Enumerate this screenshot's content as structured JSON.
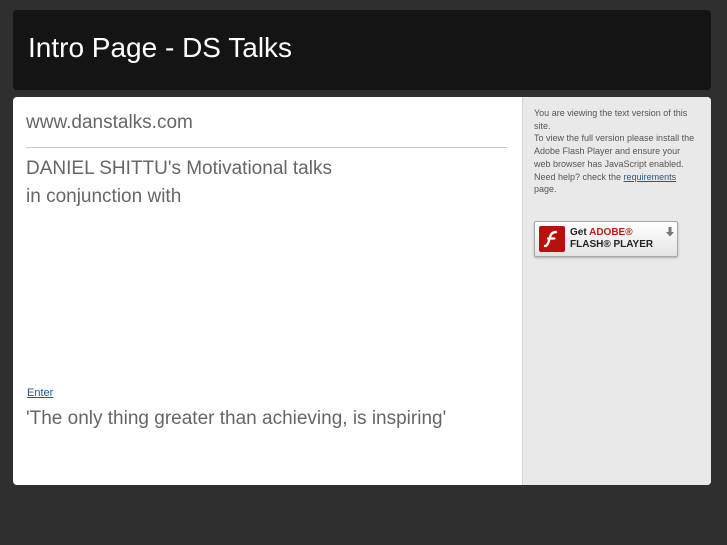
{
  "header": {
    "title": "Intro Page - DS Talks"
  },
  "main": {
    "site_url": "www.danstalks.com",
    "intro_line1": "DANIEL SHITTU's Motivational talks",
    "intro_line2": "in conjunction with",
    "enter_link": "Enter",
    "quote": "'The only thing greater than achieving, is inspiring'"
  },
  "sidebar": {
    "text1": "You are viewing the text version of this site.",
    "text2": "To view the full version please install the Adobe Flash Player and ensure your web browser has JavaScript enabled.",
    "help_prefix": "Need help? check the ",
    "help_link": "requirements",
    "help_suffix": "page.",
    "flash_badge": {
      "get": "Get",
      "adobe": "ADOBE®",
      "product": "FLASH® PLAYER",
      "icon": "flash-logo-icon"
    }
  },
  "colors": {
    "page_background": "#2f2f2f",
    "header_background": "#141414",
    "link": "#215a8c",
    "sidebar_background": "#e9e9e9",
    "adobe_red": "#c21e14"
  }
}
